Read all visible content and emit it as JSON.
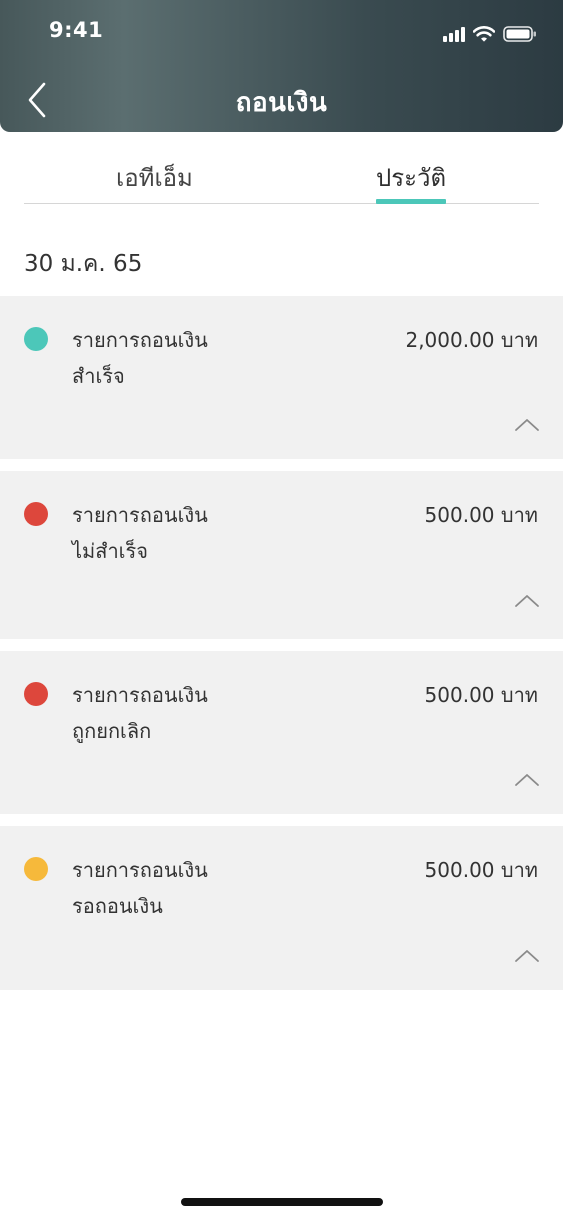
{
  "status_bar": {
    "time": "9:41"
  },
  "header": {
    "title": "ถอนเงิน"
  },
  "tabs": [
    {
      "label": "เอทีเอ็ม",
      "active": false
    },
    {
      "label": "ประวัติ",
      "active": true
    }
  ],
  "history": {
    "date": "30 ม.ค. 65",
    "items": [
      {
        "title": "รายการถอนเงิน",
        "status": "สำเร็จ",
        "amount": "2,000.00 บาท",
        "status_color": "#4cc7b9"
      },
      {
        "title": "รายการถอนเงิน",
        "status": "ไม่สำเร็จ",
        "amount": "500.00 บาท",
        "status_color": "#dd473c"
      },
      {
        "title": "รายการถอนเงิน",
        "status": "ถูกยกเลิก",
        "amount": "500.00 บาท",
        "status_color": "#dd473c"
      },
      {
        "title": "รายการถอนเงิน",
        "status": "รอถอนเงิน",
        "amount": "500.00 บาท",
        "status_color": "#f6b93b"
      }
    ]
  },
  "colors": {
    "accent": "#4cc7b9",
    "card_background": "#f1f1f1"
  },
  "icons": [
    "back-chevron-icon",
    "cellular-signal-icon",
    "wifi-icon",
    "battery-icon",
    "chevron-up-icon"
  ]
}
